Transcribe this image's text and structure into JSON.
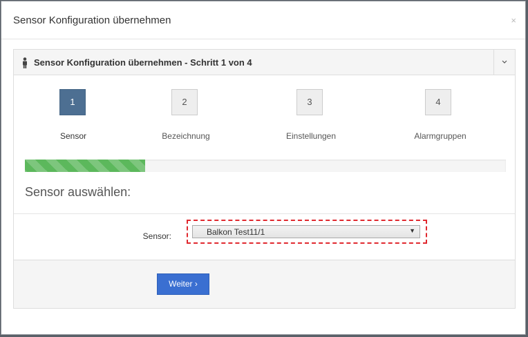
{
  "modal": {
    "title": "Sensor Konfiguration übernehmen",
    "close_glyph": "×"
  },
  "panel": {
    "icon": "person-icon",
    "title": "Sensor Konfiguration übernehmen - Schritt 1 von 4",
    "collapse_icon": "chevron-down-icon"
  },
  "steps": [
    {
      "number": "1",
      "label": "Sensor",
      "active": true
    },
    {
      "number": "2",
      "label": "Bezeichnung",
      "active": false
    },
    {
      "number": "3",
      "label": "Einstellungen",
      "active": false
    },
    {
      "number": "4",
      "label": "Alarmgruppen",
      "active": false
    }
  ],
  "progress": {
    "fraction": 0.25,
    "color": "#5cb85c"
  },
  "section_title": "Sensor auswählen:",
  "form": {
    "sensor_label": "Sensor:",
    "sensor_value": "Balkon Test11/1",
    "select_arrow": "▼"
  },
  "footer": {
    "next_button": "Weiter ›"
  },
  "colors": {
    "active_step": "#4d6f92",
    "primary_button": "#3a6fd1",
    "highlight_border": "#e0282e"
  }
}
